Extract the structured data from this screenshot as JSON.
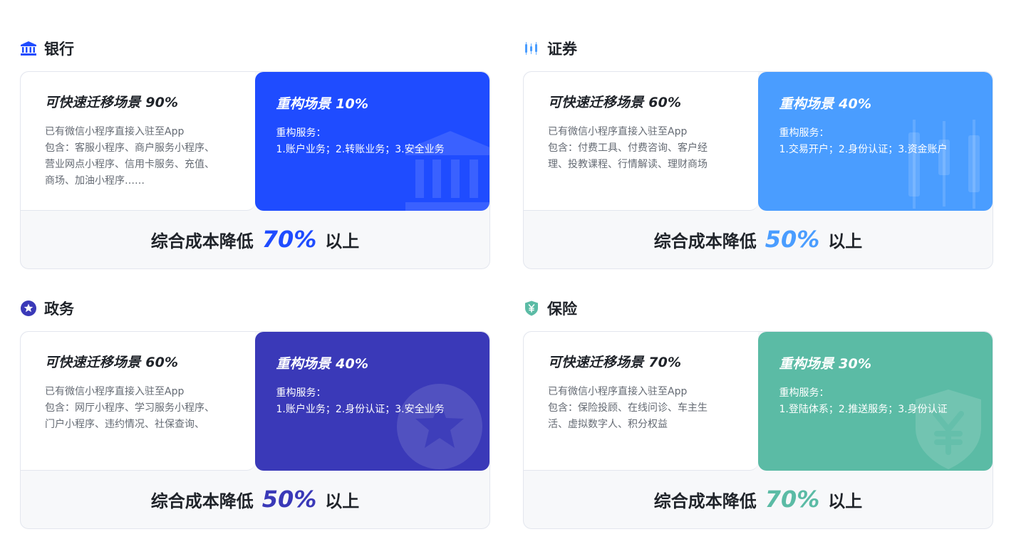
{
  "sections": [
    {
      "title": "银行",
      "icon": "bank-icon",
      "accent": "#1f4cff",
      "left_heading": "可快速迁移场景 90%",
      "left_lines": [
        "已有微信小程序直接入驻至App",
        "包含：客服小程序、商户服务小程序、",
        "营业网点小程序、信用卡服务、充值、",
        "商场、加油小程序……"
      ],
      "right_heading": "重构场景 10%",
      "right_lines": [
        "重构服务：",
        "1.账户业务；2.转账业务；3.安全业务"
      ],
      "footer_prefix": "综合成本降低",
      "footer_pct": "70%",
      "footer_suffix": "以上"
    },
    {
      "title": "证券",
      "icon": "candlestick-chart-icon",
      "accent": "#4a9dff",
      "left_heading": "可快速迁移场景 60%",
      "left_lines": [
        "已有微信小程序直接入驻至App",
        "包含：付费工具、付费咨询、客户经",
        "理、投教课程、行情解读、理财商场"
      ],
      "right_heading": "重构场景 40%",
      "right_lines": [
        "重构服务：",
        "1.交易开户；2.身份认证；3.资金账户"
      ],
      "footer_prefix": "综合成本降低",
      "footer_pct": "50%",
      "footer_suffix": "以上"
    },
    {
      "title": "政务",
      "icon": "star-badge-icon",
      "accent": "#3a39b8",
      "left_heading": "可快速迁移场景 60%",
      "left_lines": [
        "已有微信小程序直接入驻至App",
        "包含：网厅小程序、学习服务小程序、",
        "门户小程序、违约情况、社保查询、"
      ],
      "right_heading": "重构场景 40%",
      "right_lines": [
        "重构服务：",
        "1.账户业务；2.身份认证；3.安全业务"
      ],
      "footer_prefix": "综合成本降低",
      "footer_pct": "50%",
      "footer_suffix": "以上"
    },
    {
      "title": "保险",
      "icon": "yuan-shield-icon",
      "accent": "#5bbba5",
      "left_heading": "可快速迁移场景 70%",
      "left_lines": [
        "已有微信小程序直接入驻至App",
        "包含：保险投顾、在线问诊、车主生",
        "活、虚拟数字人、积分权益"
      ],
      "right_heading": "重构场景 30%",
      "right_lines": [
        "重构服务：",
        "1.登陆体系；2.推送服务；3.身份认证"
      ],
      "footer_prefix": "综合成本降低",
      "footer_pct": "70%",
      "footer_suffix": "以上"
    }
  ]
}
